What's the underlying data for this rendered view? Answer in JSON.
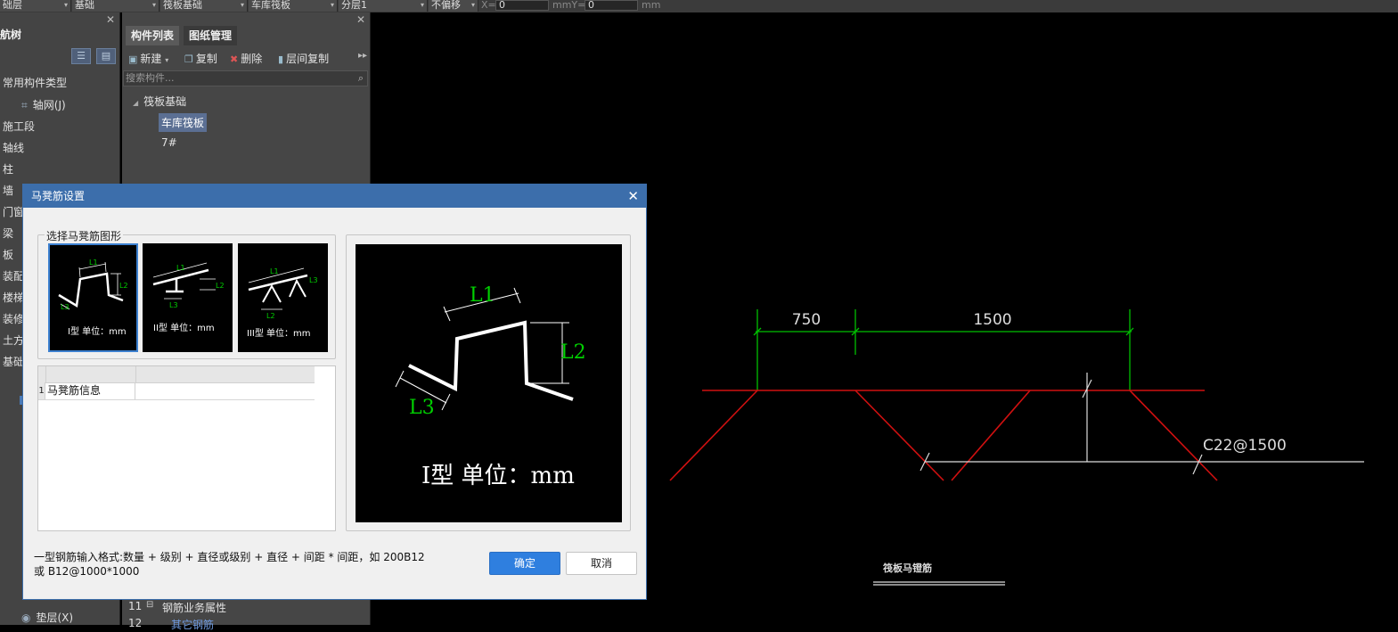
{
  "toolbar": {
    "floor_fragment": "础层",
    "floor_type": "基础",
    "component_type": "筏板基础",
    "component_name": "车库筏板",
    "layer": "分层1",
    "offset": "不偏移",
    "x_label": "X=",
    "x_value": "0",
    "mmy_label": "mmY=",
    "y_value": "0",
    "mm_label": "mm"
  },
  "nav": {
    "title": "航树",
    "items": [
      {
        "label": "常用构件类型"
      },
      {
        "label": "轴网(J)",
        "icon": "grid-icon"
      },
      {
        "label": "施工段"
      },
      {
        "label": "轴线"
      },
      {
        "label": "柱"
      },
      {
        "label": "墙"
      },
      {
        "label": "门窗"
      },
      {
        "label": "梁"
      },
      {
        "label": "板"
      },
      {
        "label": "装配"
      },
      {
        "label": "楼梯"
      },
      {
        "label": "装修"
      },
      {
        "label": "土方"
      },
      {
        "label": "基础"
      }
    ],
    "bottom_item": "垫层(X)"
  },
  "component_panel": {
    "tabs": [
      "构件列表",
      "图纸管理"
    ],
    "actions": {
      "new": "新建",
      "copy": "复制",
      "delete": "删除",
      "floor_copy": "层间复制"
    },
    "search_placeholder": "搜索构件...",
    "tree": {
      "root": "筏板基础",
      "selected": "车库筏板",
      "other": "7#"
    },
    "grid": {
      "row_11_num": "11",
      "row_11_label": "钢筋业务属性",
      "row_12_num": "12",
      "row_12_label": "其它钢筋"
    }
  },
  "cad": {
    "dim_left": "750",
    "dim_right": "1500",
    "rebar_label": "C22@1500",
    "drawing_title": "筏板马镫筋"
  },
  "dialog": {
    "title": "马凳筋设置",
    "group_label": "选择马凳筋图形",
    "shapes": [
      {
        "caption": "I型 单位：mm",
        "l1": "L1",
        "l2": "L2",
        "l3": "L3"
      },
      {
        "caption": "II型 单位：mm",
        "l1": "L1",
        "l2": "L2",
        "l3": "L3"
      },
      {
        "caption": "III型 单位：mm",
        "l1": "L1",
        "l2": "L2",
        "l3": "L3"
      }
    ],
    "table": {
      "row_num": "1",
      "row_name": "马凳筋信息",
      "row_value": ""
    },
    "preview": {
      "l1": "L1",
      "l2": "L2",
      "l3": "L3",
      "caption": "I型 单位：mm"
    },
    "hint_line1": "一型钢筋输入格式:数量 + 级别 + 直径或级别 + 直径 + 间距 * 间距，如 200B12",
    "hint_line2": "或 B12@1000*1000",
    "ok_label": "确定",
    "cancel_label": "取消"
  },
  "colors": {
    "accent": "#3c6eab",
    "ok_button": "#2f7fdf",
    "cad_dimension": "#00c000",
    "cad_rebar": "#d01010",
    "label_green": "#00d000"
  }
}
